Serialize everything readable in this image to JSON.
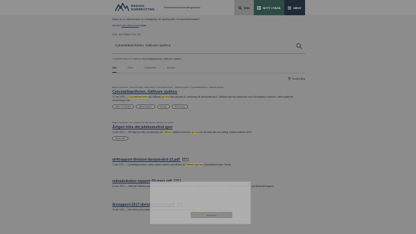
{
  "header": {
    "brand_line1": "REGION",
    "brand_line2": "NORRBOTTEN",
    "top_link": "Sekretessorbehandlingskanal",
    "search_label": "SÖK",
    "new_label": "NYTT I PÅGÅ",
    "menu_label": "MENY"
  },
  "intro": {
    "line1": "Sabin du en hälsocentral, en mottagning, ett sjukhus eller ett tandvårdsbiträde?",
    "line2_prefix": "Använd",
    "line2_link": "hitta vård-enlart",
    "line2_suffix": "istället"
  },
  "search": {
    "field_label": "SÖK INFORMATION OM",
    "query": "Cytostatikaenheten, Gällivare sjukhus",
    "filter_prefix": "1 sökträff hittades för sökfrasen",
    "filter_term": "Cytostatikaenheten, Gällivare sjukhus"
  },
  "tabs": [
    {
      "label": "Alla"
    },
    {
      "label": "Sidor"
    },
    {
      "label": "Dokument"
    },
    {
      "label": "Nyheter"
    }
  ],
  "sort_label": "Sortera lång",
  "results": [
    {
      "crumb": "Region Norrbotten › Vård och hälsa › Hitta vården › Cytostatikaenheter › Gällivare sjukhus › Cytostatikaenheten, Gällivare sjukhus",
      "title": "Cytostatikaenheten, Gällivare sjukhus",
      "snippet_a": "21 sep 2023 —",
      "snippet_hl1": "Cytostatikaenheten",
      "snippet_b": "på Gällivare",
      "snippet_hl2": "sjukhus",
      "snippet_c": "finns på plan 5, i anslutning till vårdavdelning 6. Gällivare sjukhus samverkar med Onkologiska Centrum i Luleå angående behandlingar och",
      "tags": [
        "Hälso- och sjukvård",
        "Gällivare sjukhus",
        "Onkologi",
        "Vård & hälsa"
      ],
      "pdf": ""
    },
    {
      "crumb": "Region Norrbotten › Nu › Lägg till inte alla nyheter › Nyheter och notiser",
      "title": "Årligen hörs det jubileumsfest igen",
      "snippet_a": "11 dec 2021 — Så några av våra medarbetare på",
      "snippet_hl1": "Gällivare",
      "snippet_b": "sjukhus som firar",
      "snippet_hl2": "sjukhus",
      "snippet_c": "och vill tacka alla som deltog i jubileumsfesten 2022.",
      "tags": [
        "Arbetet 2023"
      ],
      "pdf": ""
    },
    {
      "crumb": "",
      "title": "driftrapport-division-länsjukvård-12.pdf",
      "snippet_a": "2 mar 2021 — Cytostatikaenheten mellan vården framför sjukvården vid",
      "snippet_hl1": "Gällivare",
      "snippet_b": "",
      "snippet_hl2": "sjukhus",
      "snippet_c": "Cytostatikaenheten. Beslut.",
      "tags": [],
      "pdf": "PDF"
    },
    {
      "crumb": "",
      "title": "månadsledare-rapport-20-mars.pdf",
      "snippet_a": "11 dec 2021 — Vård på Gällivare sjukhus. Gällivare sjukhus och Piteå sjukhus, fyra åtgärder på",
      "snippet_hl1": "Gällivare",
      "snippet_b": "",
      "snippet_hl2": "sjukhus",
      "snippet_c": "samt förbättringsarbete på vårdavdelningarna.",
      "tags": [],
      "pdf": "PDF"
    },
    {
      "crumb": "",
      "title": "årsrapport-2017-division-service.pdf",
      "snippet_a": "20 okt 2018 — Med fokus på produktionsförbättringar och samarbete mellan",
      "snippet_hl1": "Gällivare",
      "snippet_b": "",
      "snippet_hl2": "sjukhus",
      "snippet_c": "och Sunderby sjukhus.",
      "tags": [],
      "pdf": "PDF"
    }
  ],
  "overlay": {
    "button_label": "Acceptera"
  },
  "colors": {
    "header_new": "#2d4b45",
    "header_menu": "#1e2a35",
    "highlight": "#b3a95c",
    "link": "#1d2d48"
  }
}
